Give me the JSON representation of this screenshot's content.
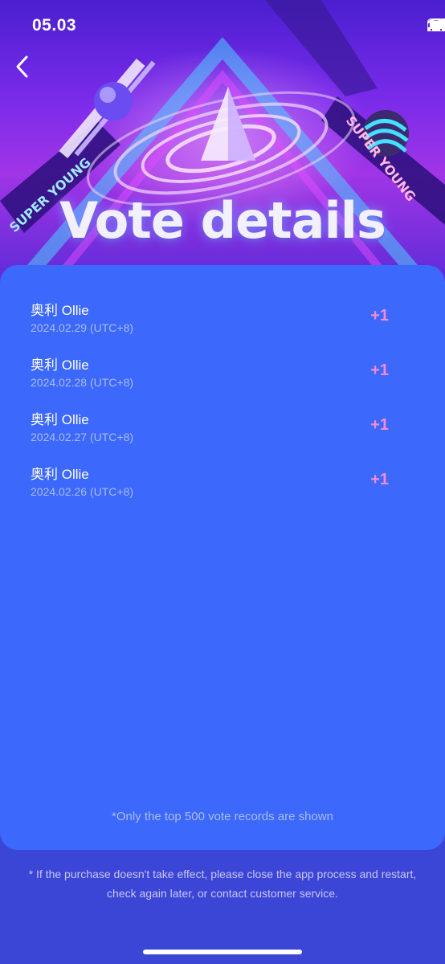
{
  "status_bar": {
    "time": "05.03"
  },
  "header": {
    "title": "Vote details",
    "banner_text": "SUPER YOUNG",
    "back_icon": "chevron-left-icon"
  },
  "votes": [
    {
      "name": "奥利 Ollie",
      "date": "2024.02.29 (UTC+8)",
      "count": "+1"
    },
    {
      "name": "奥利 Ollie",
      "date": "2024.02.28 (UTC+8)",
      "count": "+1"
    },
    {
      "name": "奥利 Ollie",
      "date": "2024.02.27 (UTC+8)",
      "count": "+1"
    },
    {
      "name": "奥利 Ollie",
      "date": "2024.02.26 (UTC+8)",
      "count": "+1"
    }
  ],
  "card": {
    "footnote": "*Only the top 500 vote records are shown"
  },
  "notice": {
    "line1": "* If the purchase doesn't take effect, please close the app process and restart,",
    "line2": "check again later, or contact customer service."
  },
  "colors": {
    "card_background": "#3c68fb",
    "page_background": "#3b46d6",
    "vote_count": "#f58ad8",
    "secondary_text": "#a9bcf8"
  }
}
